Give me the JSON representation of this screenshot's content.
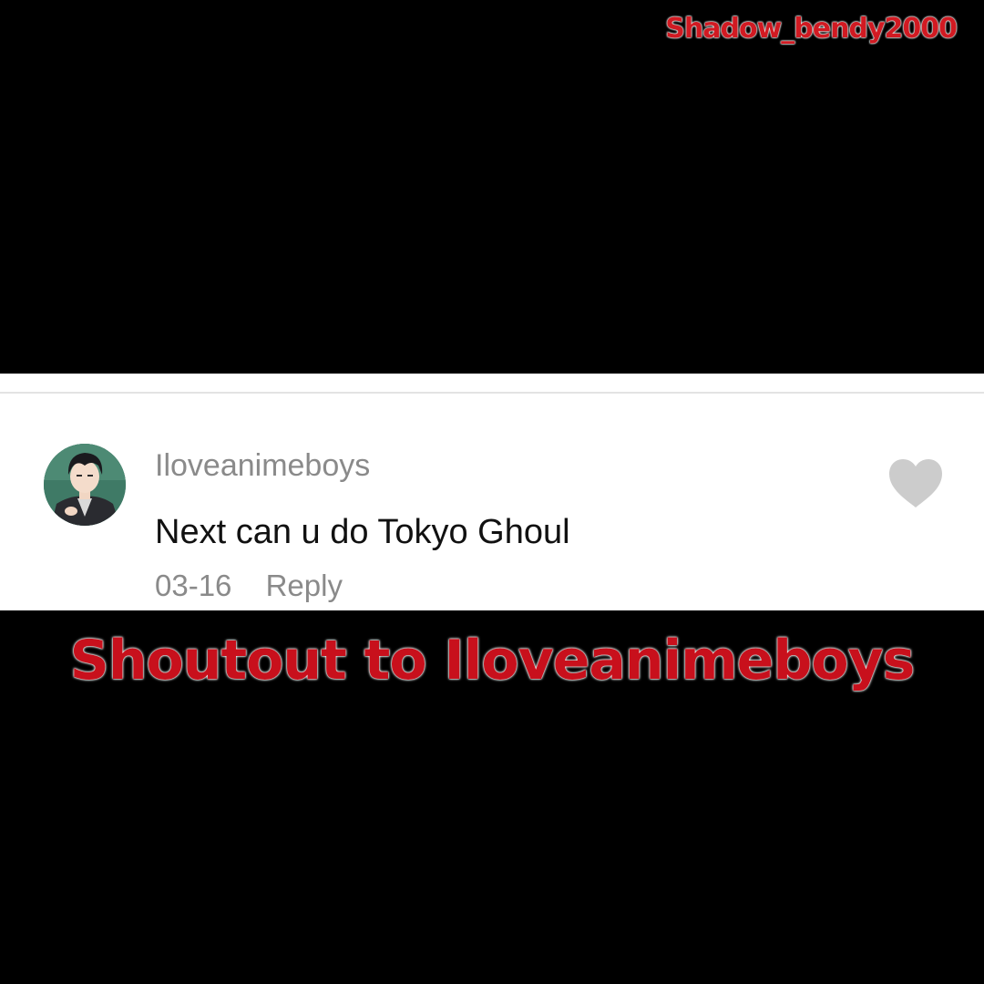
{
  "watermark": {
    "text": "Shadow_bendy2000"
  },
  "comment": {
    "avatar_icon": "user-avatar-icon",
    "username": "Iloveanimeboys",
    "text": "Next can u do Tokyo Ghoul",
    "date": "03-16",
    "reply_label": "Reply",
    "like_icon": "heart-icon"
  },
  "caption": {
    "text": "Shoutout to Iloveanimeboys"
  },
  "colors": {
    "background": "#000000",
    "card": "#ffffff",
    "accent_red": "#c8101c",
    "muted_gray": "#8a8a8a",
    "heart_gray": "#cccccc"
  }
}
